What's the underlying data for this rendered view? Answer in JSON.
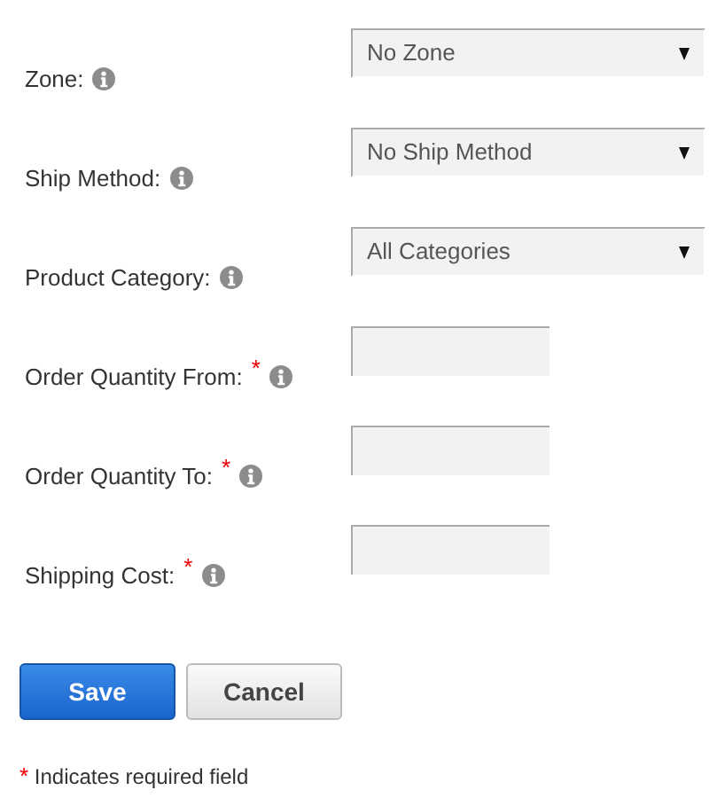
{
  "fields": [
    {
      "label": "Zone:",
      "required": false,
      "kind": "select",
      "value": "No Zone"
    },
    {
      "label": "Ship Method:",
      "required": false,
      "kind": "select",
      "value": "No Ship Method"
    },
    {
      "label": "Product Category:",
      "required": false,
      "kind": "select",
      "value": "All Categories"
    },
    {
      "label": "Order Quantity From:",
      "required": true,
      "kind": "text"
    },
    {
      "label": "Order Quantity To:",
      "required": true,
      "kind": "text"
    },
    {
      "label": "Shipping Cost:",
      "required": true,
      "kind": "text"
    }
  ],
  "required_mark": "*",
  "buttons": [
    {
      "label": "Save",
      "kind": "primary"
    },
    {
      "label": "Cancel",
      "kind": "secondary"
    }
  ],
  "note": {
    "mark": "*",
    "text": "Indicates required field"
  }
}
